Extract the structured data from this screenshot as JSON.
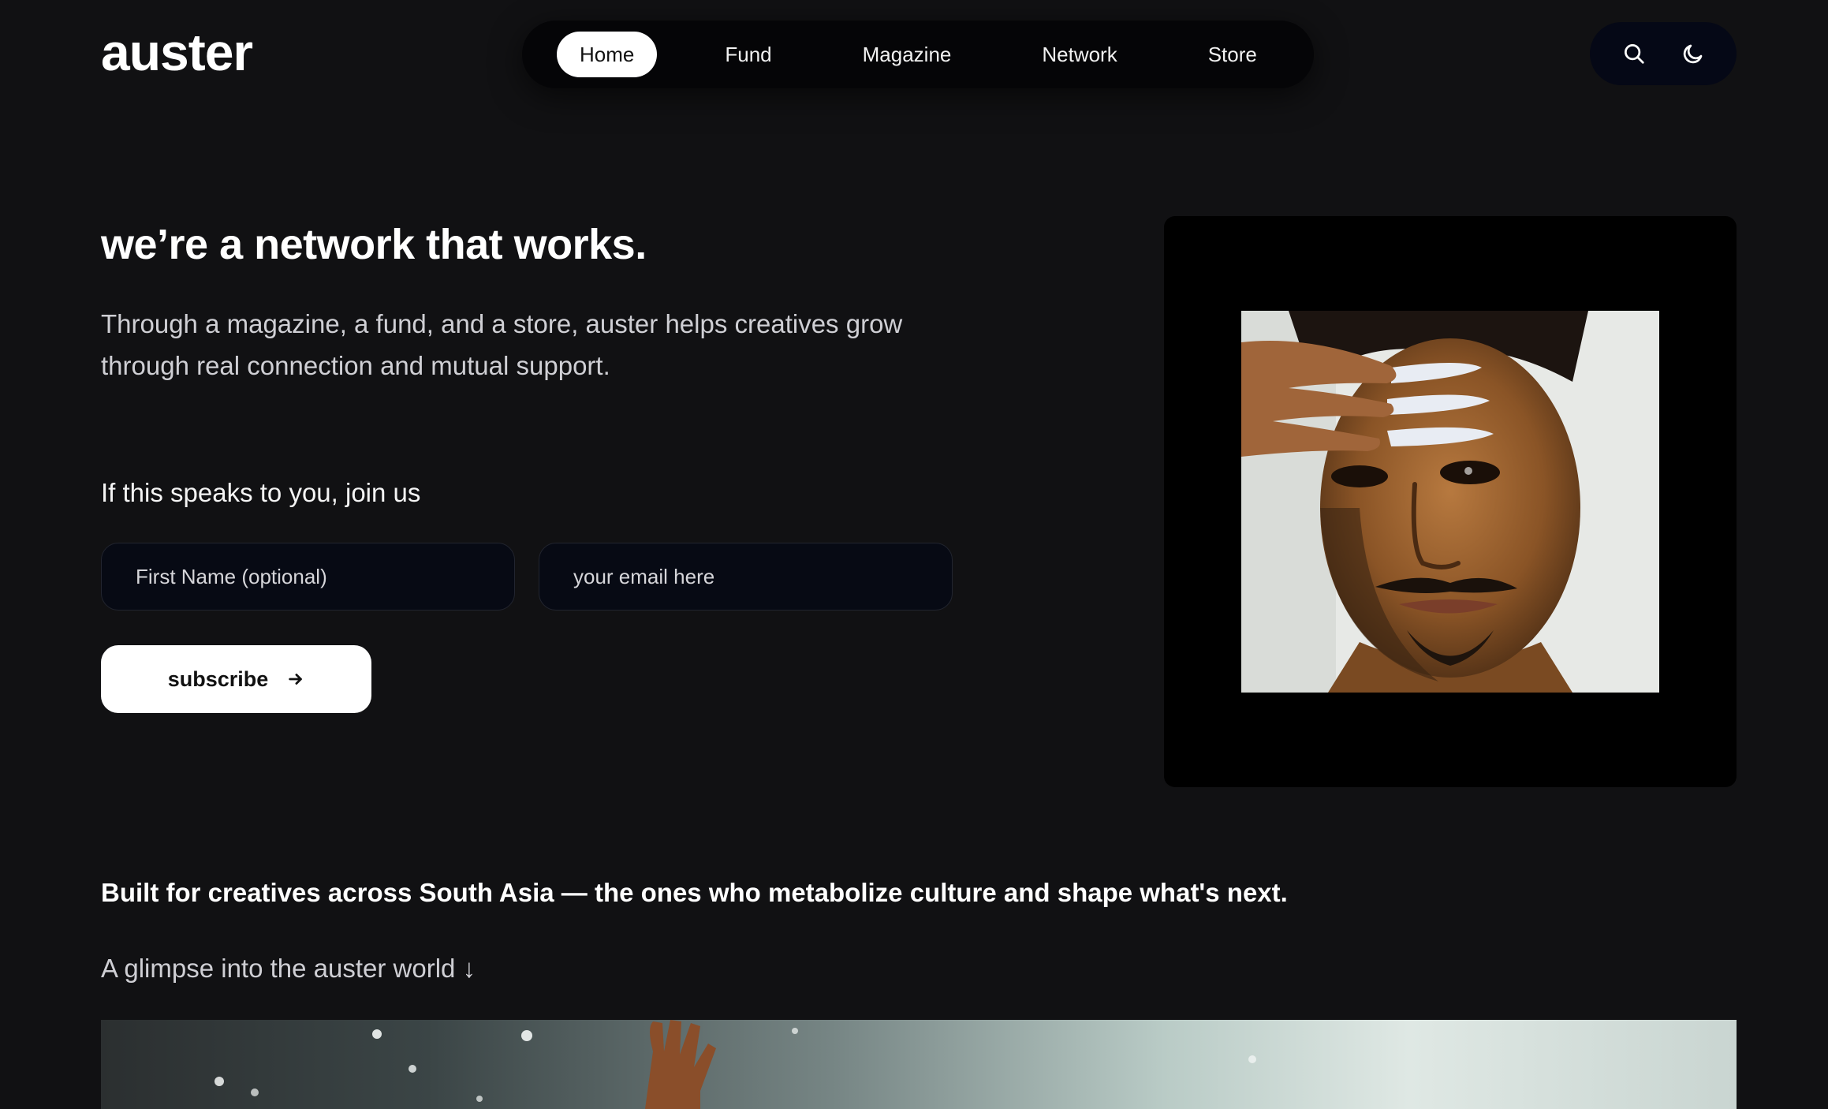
{
  "brand": {
    "logo": "auster"
  },
  "nav": {
    "items": [
      {
        "label": "Home",
        "active": true
      },
      {
        "label": "Fund",
        "active": false
      },
      {
        "label": "Magazine",
        "active": false
      },
      {
        "label": "Network",
        "active": false
      },
      {
        "label": "Store",
        "active": false
      }
    ]
  },
  "tools": {
    "search_icon": "search-icon",
    "theme_icon": "moon-icon"
  },
  "hero": {
    "headline": "we’re a network that works.",
    "lede": "Through a magazine, a fund, and a store, auster helps creatives grow through real connection and mutual support.",
    "join_text": "If this speaks to you, join us",
    "name_placeholder": "First Name (optional)",
    "email_placeholder": "your email here",
    "subscribe_label": "subscribe"
  },
  "lower": {
    "tagline": "Built for creatives across South Asia — the ones who metabolize culture and shape what's next.",
    "glimpse": "A glimpse into the auster world ↓"
  },
  "colors": {
    "background": "#111113",
    "nav_bg": "#050507",
    "tools_bg": "#050816",
    "field_bg": "#070a14",
    "card_bg": "#000000",
    "text": "#ffffff",
    "muted_text": "#cfcfd4"
  }
}
